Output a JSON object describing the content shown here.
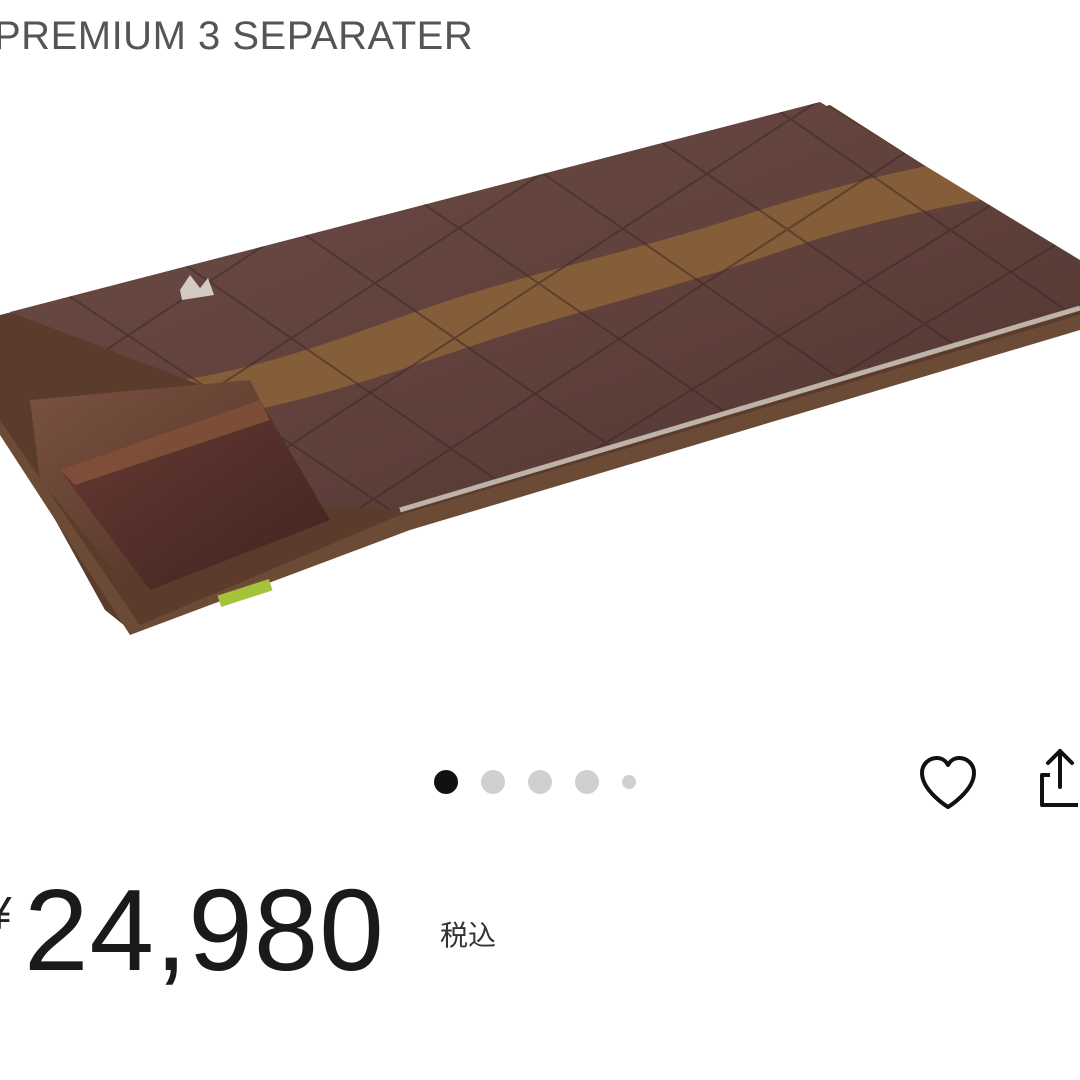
{
  "product": {
    "title": "PREMIUM 3 SEPARATER",
    "image_alt": "sleeping-bag-photo"
  },
  "carousel": {
    "total": 5,
    "active_index": 0
  },
  "actions": {
    "like_icon": "heart-outline-icon",
    "share_icon": "share-icon"
  },
  "price": {
    "currency": "¥",
    "amount": "24,980",
    "tax_label": "税込"
  }
}
